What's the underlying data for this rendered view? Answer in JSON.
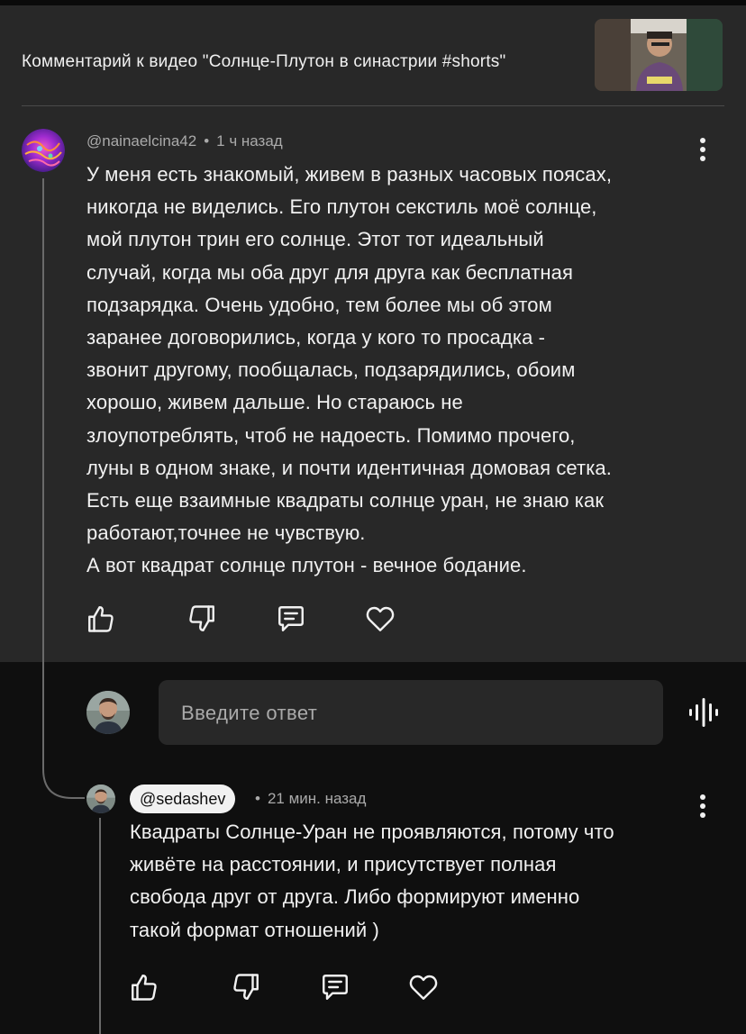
{
  "header": {
    "title": "Комментарий к видео \"Солнце-Плутон в синастрии #shorts\""
  },
  "comment": {
    "author": "@nainaelcina42",
    "time": "1 ч назад",
    "text": "У меня есть знакомый, живем в разных часовых поясах,\nникогда не виделись. Его плутон секстиль моё солнце,\nмой плутон трин его солнце. Этот тот идеальный\nслучай, когда мы оба друг для друга как бесплатная\nподзарядка. Очень удобно, тем более мы об этом\nзаранее договорились, когда у кого то просадка -\nзвонит другому, пообщалась, подзарядились, обоим\nхорошо, живем дальше. Но стараюсь не\nзлоупотреблять, чтоб не надоесть. Помимо прочего,\nлуны в одном знаке, и почти идентичная домовая сетка.\nЕсть еще взаимные квадраты солнце уран, не знаю как\nработают,точнее не чувствую.\nА вот квадрат солнце плутон - вечное бодание."
  },
  "reply_box": {
    "placeholder": "Введите ответ"
  },
  "reply": {
    "author": "@sedashev",
    "time": "21 мин. назад",
    "text": "Квадраты Солнце-Уран не проявляются, потому что\nживёте на расстоянии, и присутствует полная\nсвобода друг от друга. Либо формируют именно\nтакой формат отношений )"
  },
  "dot_separator": "•",
  "icons": [
    "kebab-menu-icon",
    "thumbs-up-icon",
    "thumbs-down-icon",
    "reply-icon",
    "heart-icon",
    "voice-input-icon"
  ]
}
